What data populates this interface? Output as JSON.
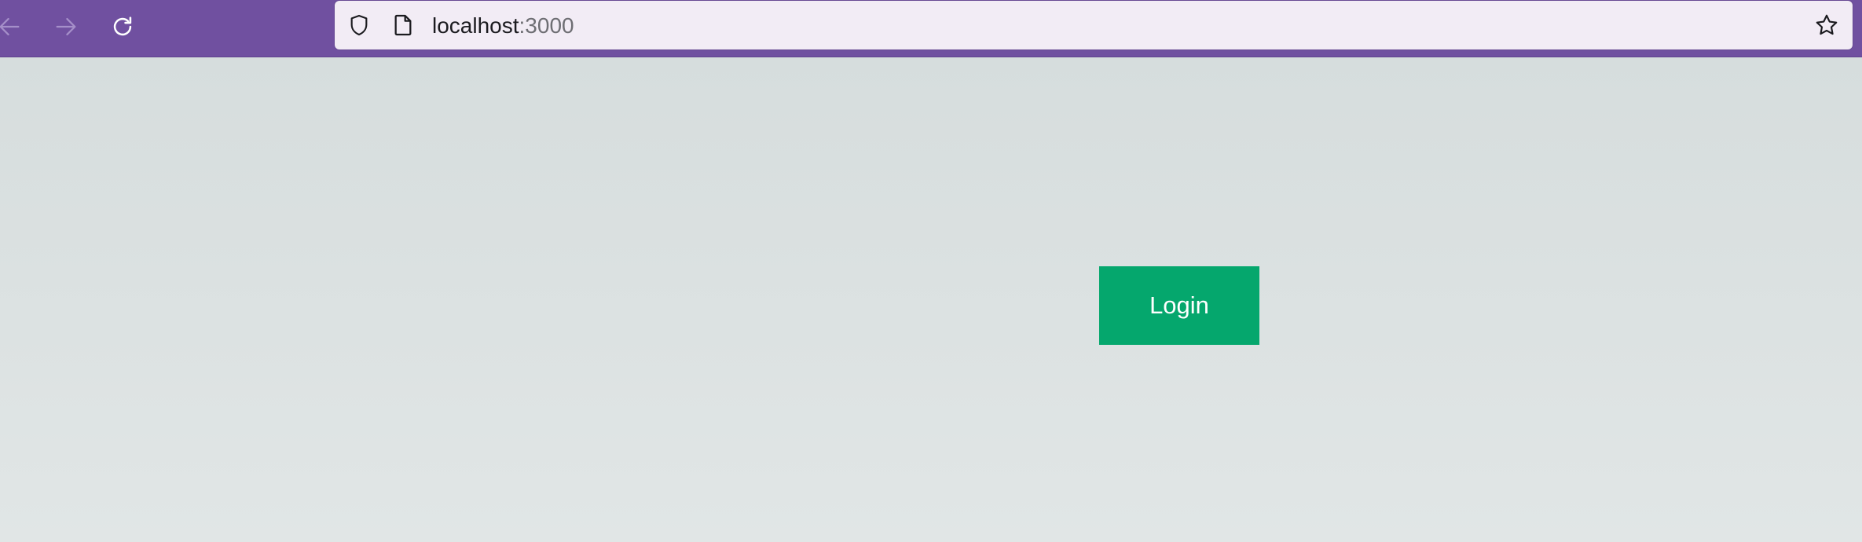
{
  "browser": {
    "url_host": "localhost",
    "url_port": ":3000",
    "toolbar_color": "#7050a0",
    "nav_icons": [
      "back-arrow-icon",
      "forward-arrow-icon",
      "reload-icon"
    ],
    "url_icons": [
      "shield-icon",
      "page-icon",
      "bookmark-star-icon"
    ]
  },
  "page": {
    "background": "#dbe1e1",
    "login_label": "Login",
    "login_color": "#05a76d"
  }
}
